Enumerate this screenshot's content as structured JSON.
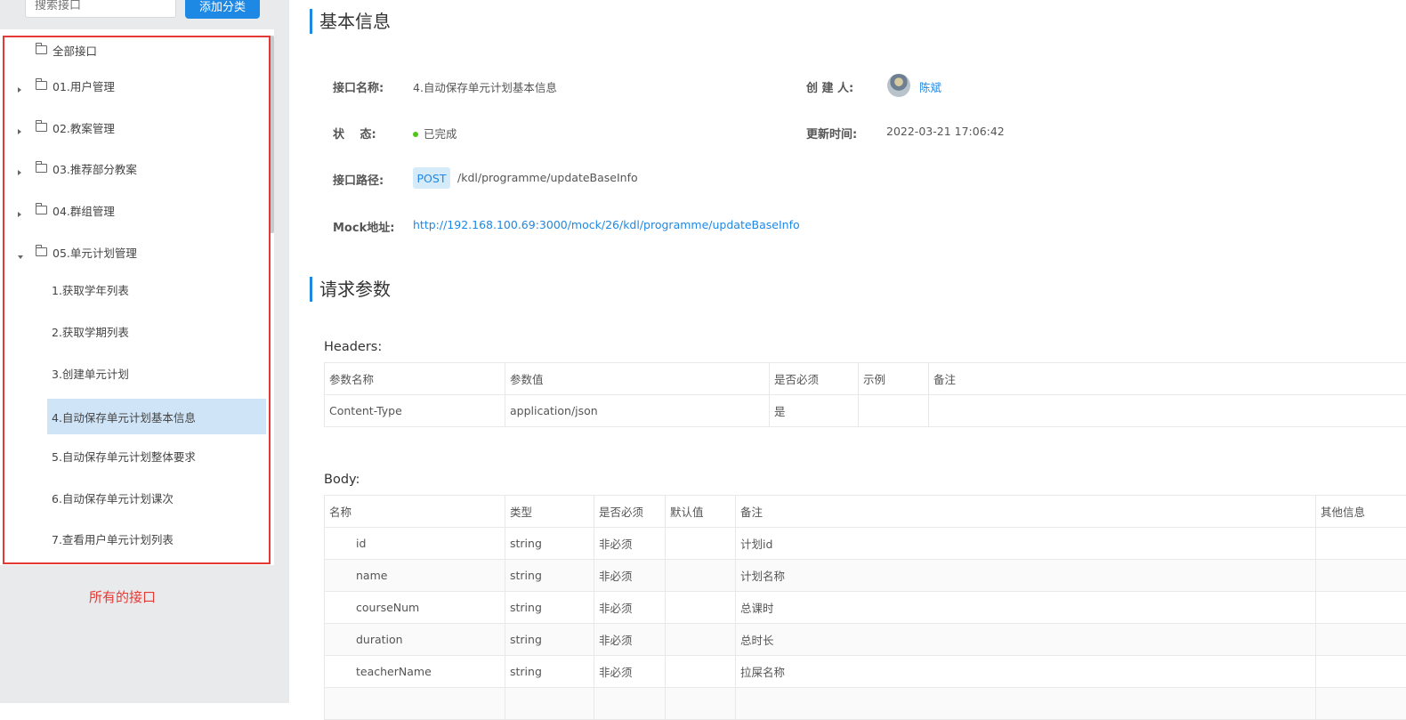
{
  "sidebar": {
    "search_placeholder": "搜索接口",
    "add_category_label": "添加分类",
    "tree": {
      "all_label": "全部接口",
      "folders": [
        {
          "label": "01.用户管理",
          "expanded": false
        },
        {
          "label": "02.教案管理",
          "expanded": false
        },
        {
          "label": "03.推荐部分教案",
          "expanded": false
        },
        {
          "label": "04.群组管理",
          "expanded": false
        },
        {
          "label": "05.单元计划管理",
          "expanded": true
        }
      ],
      "items": [
        {
          "label": "1.获取学年列表",
          "active": false
        },
        {
          "label": "2.获取学期列表",
          "active": false
        },
        {
          "label": "3.创建单元计划",
          "active": false
        },
        {
          "label": "4.自动保存单元计划基本信息",
          "active": true
        },
        {
          "label": "5.自动保存单元计划整体要求",
          "active": false
        },
        {
          "label": "6.自动保存单元计划课次",
          "active": false
        },
        {
          "label": "7.查看用户单元计划列表",
          "active": false
        }
      ]
    },
    "annotation_note": "所有的接口"
  },
  "basic_info": {
    "title": "基本信息",
    "name_label": "接口名称:",
    "name_value": "4.自动保存单元计划基本信息",
    "creator_label": "创 建 人:",
    "creator_value": "陈斌",
    "status_label": "状　 态:",
    "status_value": "已完成",
    "updated_label": "更新时间:",
    "updated_value": "2022-03-21 17:06:42",
    "path_label": "接口路径:",
    "method": "POST",
    "path_value": "/kdl/programme/updateBaseInfo",
    "mock_label": "Mock地址:",
    "mock_url": "http://192.168.100.69:3000/mock/26/kdl/programme/updateBaseInfo"
  },
  "request": {
    "title": "请求参数",
    "headers_heading": "Headers:",
    "headers_columns": [
      "参数名称",
      "参数值",
      "是否必须",
      "示例",
      "备注"
    ],
    "headers_rows": [
      [
        "Content-Type",
        "application/json",
        "是",
        "",
        ""
      ]
    ],
    "body_heading": "Body:",
    "body_columns": [
      "名称",
      "类型",
      "是否必须",
      "默认值",
      "备注",
      "其他信息"
    ],
    "body_rows": [
      [
        "id",
        "string",
        "非必须",
        "",
        "计划id",
        ""
      ],
      [
        "name",
        "string",
        "非必须",
        "",
        "计划名称",
        ""
      ],
      [
        "courseNum",
        "string",
        "非必须",
        "",
        "总课时",
        ""
      ],
      [
        "duration",
        "string",
        "非必须",
        "",
        "总时长",
        ""
      ],
      [
        "teacherName",
        "string",
        "非必须",
        "",
        "拉屎名称",
        ""
      ]
    ]
  },
  "colors": {
    "accent": "#1e88e5",
    "highlight_border": "#e53935",
    "active_item_bg": "#cfe4f6",
    "status_done": "#52c41a"
  }
}
